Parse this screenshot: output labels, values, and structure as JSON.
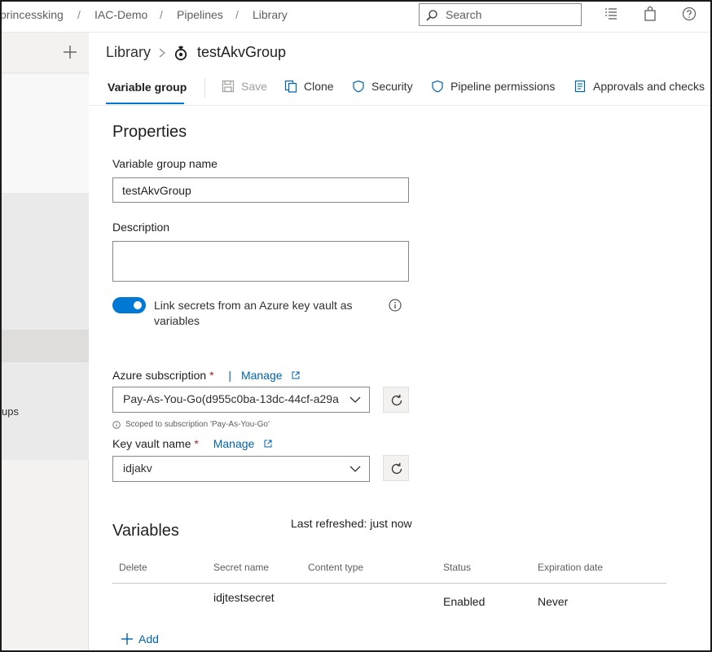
{
  "breadcrumb": {
    "org": "princessking",
    "project": "IAC-Demo",
    "section": "Pipelines",
    "page": "Library",
    "separator": "/"
  },
  "search": {
    "placeholder": "Search"
  },
  "top_icons": [
    "task-list-icon",
    "shopping-bag-icon",
    "help-icon"
  ],
  "sidebar": {
    "partial_item_text": "ups"
  },
  "header": {
    "library": "Library",
    "group_name": "testAkvGroup"
  },
  "toolbar": {
    "active_tab": "Variable group",
    "save": "Save",
    "clone": "Clone",
    "security": "Security",
    "pipeline_permissions": "Pipeline permissions",
    "approvals": "Approvals and checks"
  },
  "properties": {
    "title": "Properties",
    "name_label": "Variable group name",
    "name_value": "testAkvGroup",
    "description_label": "Description",
    "description_value": "",
    "link_secrets_label": "Link secrets from an Azure key vault as variables",
    "link_secrets_on": true
  },
  "keyvault": {
    "subscription_label": "Azure subscription",
    "required_mark": "*",
    "manage": "Manage",
    "divider": "|",
    "subscription_value": "Pay-As-You-Go(d955c0ba-13dc-44cf-a29a",
    "scope_note": "Scoped to subscription 'Pay-As-You-Go'",
    "vault_label": "Key vault name",
    "vault_value": "idjakv"
  },
  "variables": {
    "title": "Variables",
    "last_refreshed": "Last refreshed: just now",
    "columns": [
      "Delete",
      "Secret name",
      "Content type",
      "Status",
      "Expiration date"
    ],
    "rows": [
      {
        "delete": "",
        "secret_name": "idjtestsecret",
        "content_type": "",
        "status": "Enabled",
        "expiration": "Never"
      }
    ],
    "add": "Add"
  },
  "colors": {
    "accent": "#0078d4",
    "link": "#0063b1",
    "required": "#a4262c"
  }
}
